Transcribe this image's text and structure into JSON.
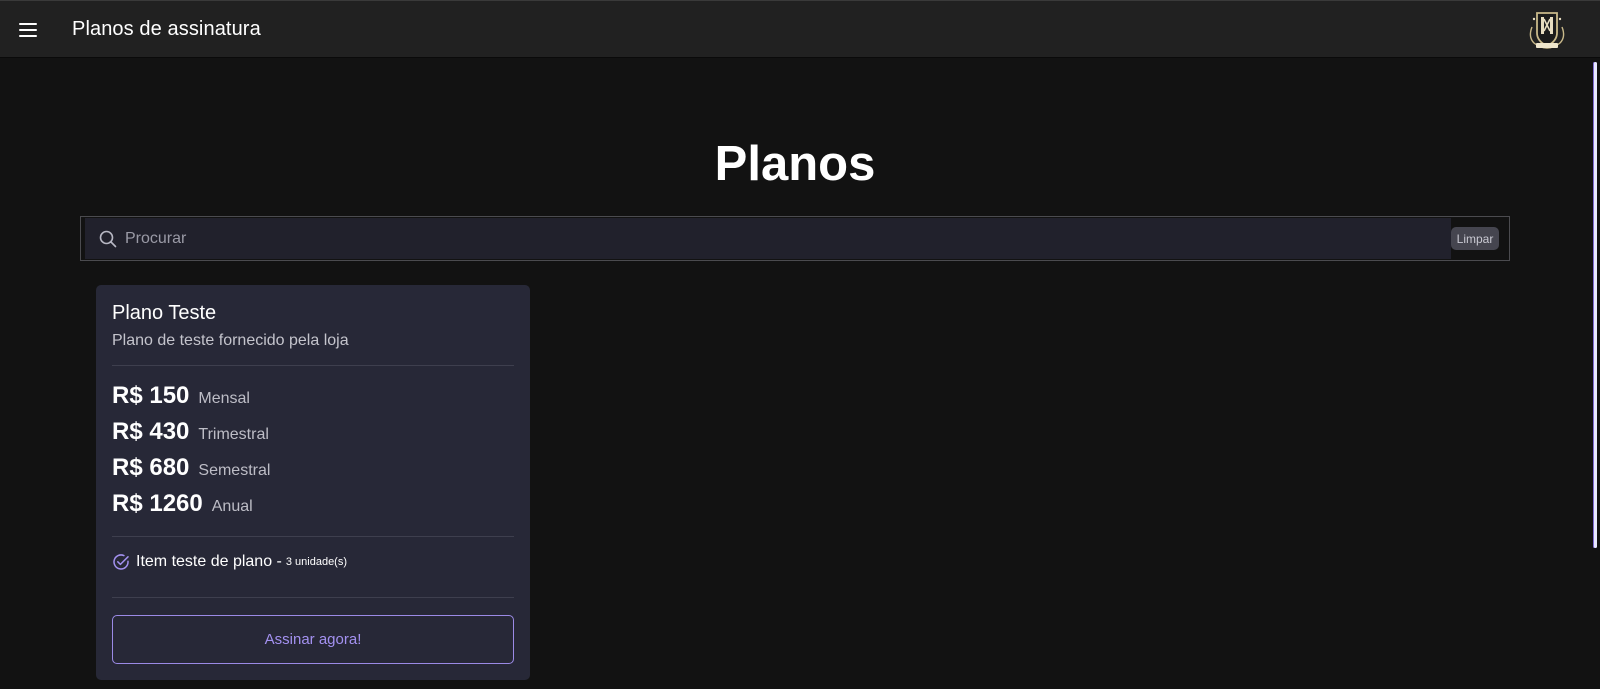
{
  "appbar": {
    "title": "Planos de assinatura",
    "menu_icon": "hamburger-menu-icon",
    "logo_icon": "club-crest-logo"
  },
  "page": {
    "title": "Planos"
  },
  "search": {
    "placeholder": "Procurar",
    "value": "",
    "clear_label": "Limpar",
    "icon": "search-icon"
  },
  "plans": [
    {
      "title": "Plano Teste",
      "description": "Plano de teste fornecido pela loja",
      "prices": [
        {
          "amount": "R$ 150",
          "period": "Mensal"
        },
        {
          "amount": "R$ 430",
          "period": "Trimestral"
        },
        {
          "amount": "R$ 680",
          "period": "Semestral"
        },
        {
          "amount": "R$ 1260",
          "period": "Anual"
        }
      ],
      "features": [
        {
          "text": "Item teste de plano - ",
          "quantity": "3 unidade(s)",
          "icon": "check-circle-icon"
        }
      ],
      "cta_label": "Assinar agora!"
    }
  ],
  "colors": {
    "background": "#121212",
    "appbar": "#212121",
    "card": "#272837",
    "accent": "#a391f0"
  }
}
